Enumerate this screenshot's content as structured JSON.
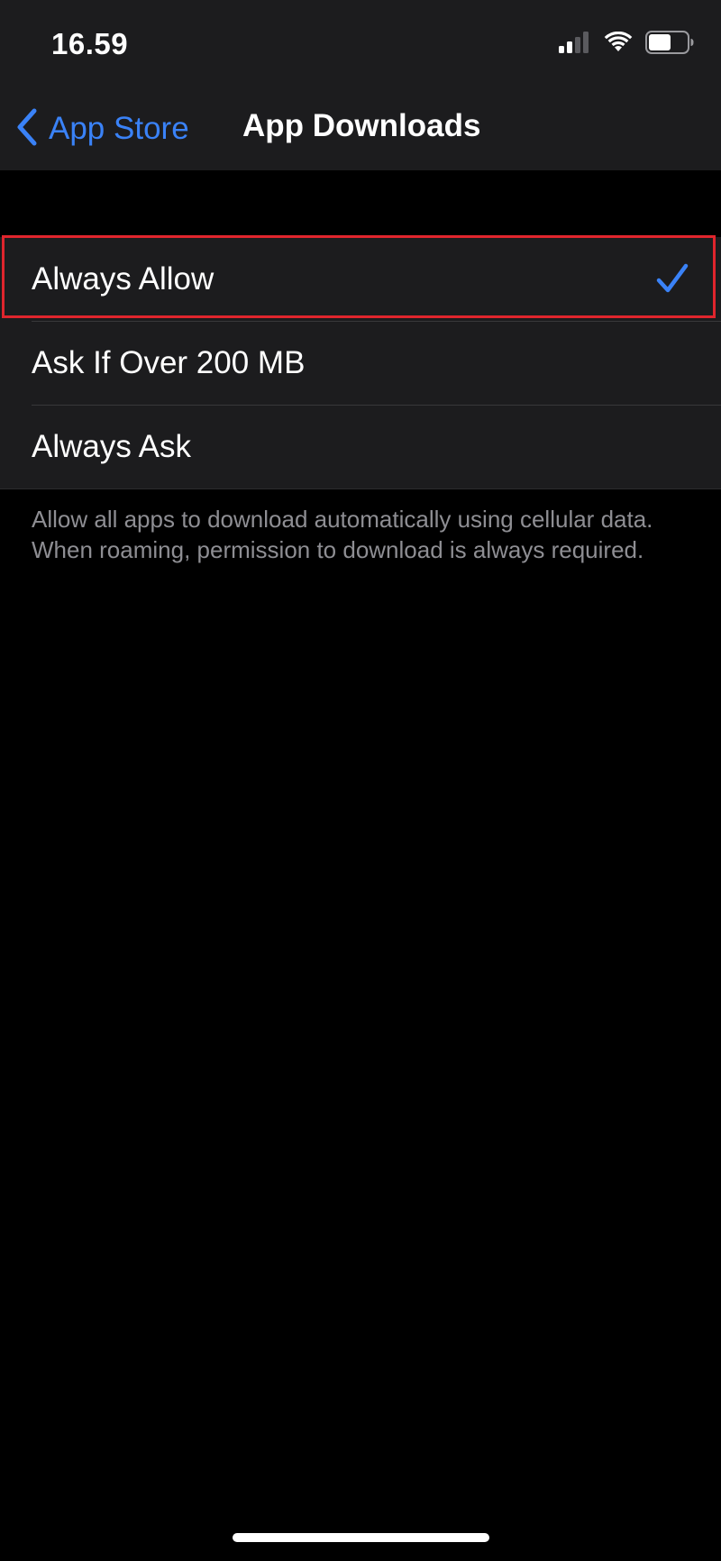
{
  "status_bar": {
    "time": "16.59",
    "icons": [
      "cellular-signal-icon",
      "wifi-icon",
      "battery-icon"
    ],
    "battery_level": 0.6
  },
  "nav": {
    "back_label": "App Store",
    "title": "App Downloads"
  },
  "options": [
    {
      "label": "Always Allow",
      "selected": true
    },
    {
      "label": "Ask If Over 200 MB",
      "selected": false
    },
    {
      "label": "Always Ask",
      "selected": false
    }
  ],
  "footer": {
    "text": "Allow all apps to download automatically using cellular data. When roaming, permission to download is always required."
  },
  "colors": {
    "accent": "#3a82f7",
    "highlight": "#e0252d",
    "group_background": "#1c1c1e",
    "secondary_text": "#8e8e93"
  }
}
